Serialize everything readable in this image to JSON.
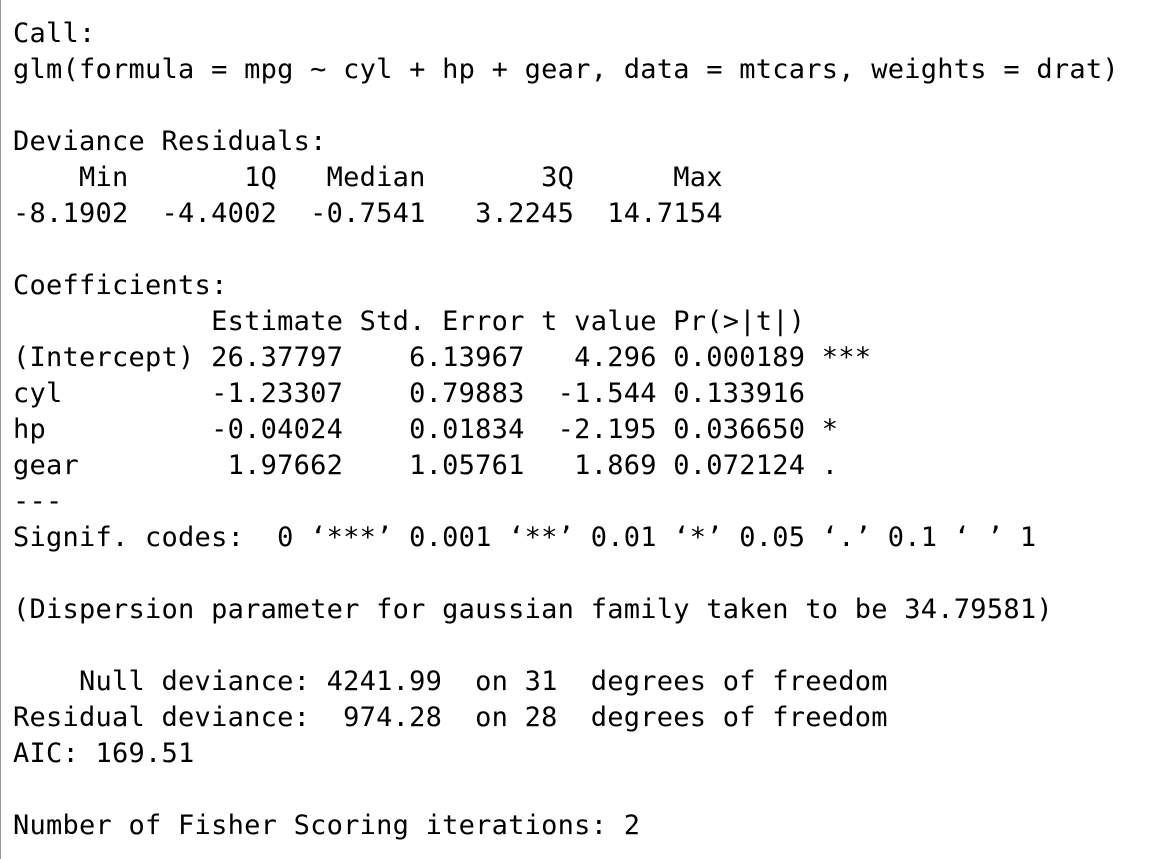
{
  "console": {
    "lines": [
      "Call:",
      "glm(formula = mpg ~ cyl + hp + gear, data = mtcars, weights = drat)",
      "",
      "Deviance Residuals:",
      "    Min       1Q   Median       3Q      Max",
      "-8.1902  -4.4002  -0.7541   3.2245  14.7154",
      "",
      "Coefficients:",
      "            Estimate Std. Error t value Pr(>|t|)",
      "(Intercept) 26.37797    6.13967   4.296 0.000189 ***",
      "cyl         -1.23307    0.79883  -1.544 0.133916",
      "hp          -0.04024    0.01834  -2.195 0.036650 *",
      "gear         1.97662    1.05761   1.869 0.072124 .",
      "---",
      "Signif. codes:  0 ‘***’ 0.001 ‘**’ 0.01 ‘*’ 0.05 ‘.’ 0.1 ‘ ’ 1",
      "",
      "(Dispersion parameter for gaussian family taken to be 34.79581)",
      "",
      "    Null deviance: 4241.99  on 31  degrees of freedom",
      "Residual deviance:  974.28  on 28  degrees of freedom",
      "AIC: 169.51",
      "",
      "Number of Fisher Scoring iterations: 2"
    ]
  }
}
